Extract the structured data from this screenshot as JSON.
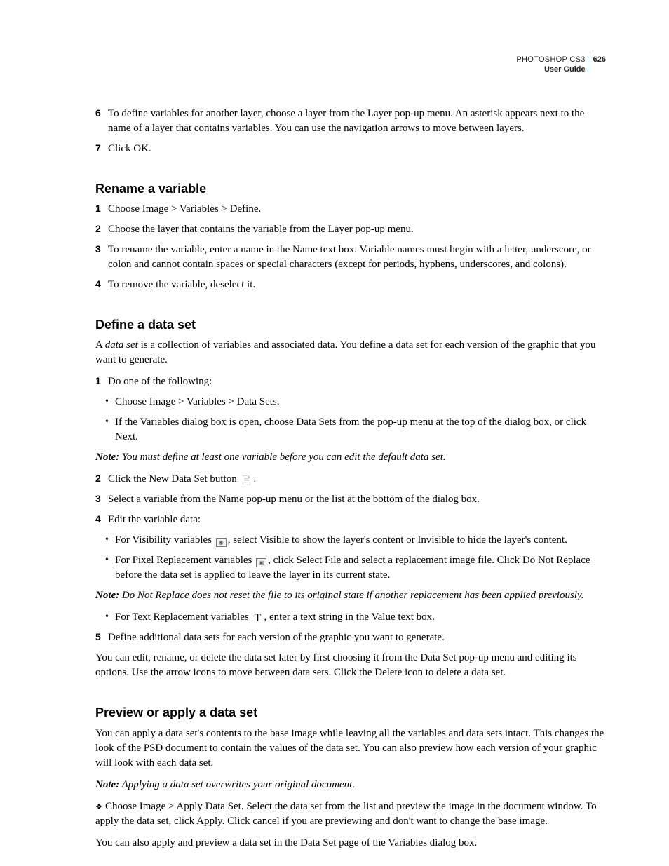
{
  "header": {
    "product": "PHOTOSHOP CS3",
    "page_number": "626",
    "doc_type": "User Guide"
  },
  "intro_steps": {
    "step6": "To define variables for another layer, choose a layer from the Layer pop-up menu. An asterisk appears next to the name of a layer that contains variables. You can use the navigation arrows to move between layers.",
    "step7": "Click OK."
  },
  "rename": {
    "heading": "Rename a variable",
    "step1": "Choose Image > Variables > Define.",
    "step2": "Choose the layer that contains the variable from the Layer pop-up menu.",
    "step3": "To rename the variable, enter a name in the Name text box. Variable names must begin with a letter, underscore, or colon and cannot contain spaces or special characters (except for periods, hyphens, underscores, and colons).",
    "step4": "To remove the variable, deselect it."
  },
  "define": {
    "heading": "Define a data set",
    "intro_a": "A ",
    "intro_term": "data set",
    "intro_b": " is a collection of variables and associated data. You define a data set for each version of the graphic that you want to generate.",
    "step1": "Do one of the following:",
    "bullet1a": "Choose Image > Variables > Data Sets.",
    "bullet1b": "If the Variables dialog box is open, choose Data Sets from the pop-up menu at the top of the dialog box, or click Next.",
    "note1_label": "Note:",
    "note1_text": " You must define at least one variable before you can edit the default data set.",
    "step2_a": "Click the New Data Set button ",
    "step2_b": ".",
    "step3": "Select a variable from the Name pop-up menu or the list at the bottom of the dialog box.",
    "step4": "Edit the variable data:",
    "bullet4a_a": "For Visibility variables ",
    "bullet4a_b": ", select Visible to show the layer's content or Invisible to hide the layer's content.",
    "bullet4b_a": "For Pixel Replacement variables ",
    "bullet4b_b": ", click Select File and select a replacement image file. Click Do Not Replace before the data set is applied to leave the layer in its current state.",
    "note2_label": "Note:",
    "note2_text": " Do Not Replace does not reset the file to its original state if another replacement has been applied previously.",
    "bullet4c_a": "For Text Replacement variables ",
    "bullet4c_b": ", enter a text string in the Value text box.",
    "step5": "Define additional data sets for each version of the graphic you want to generate.",
    "outro": "You can edit, rename, or delete the data set later by first choosing it from the Data Set pop-up menu and editing its options. Use the arrow icons to move between data sets. Click the Delete icon to delete a data set."
  },
  "preview": {
    "heading": "Preview or apply a data set",
    "p1": "You can apply a data set's contents to the base image while leaving all the variables and data sets intact. This changes the look of the PSD document to contain the values of the data set. You can also preview how each version of your graphic will look with each data set.",
    "note_label": "Note:",
    "note_text": " Applying a data set overwrites your original document.",
    "diamond_text": "Choose Image > Apply Data Set. Select the data set from the list and preview the image in the document window. To apply the data set, click Apply. Click cancel if you are previewing and don't want to change the base image.",
    "p3": "You can also apply and preview a data set in the Data Set page of the Variables dialog box."
  }
}
